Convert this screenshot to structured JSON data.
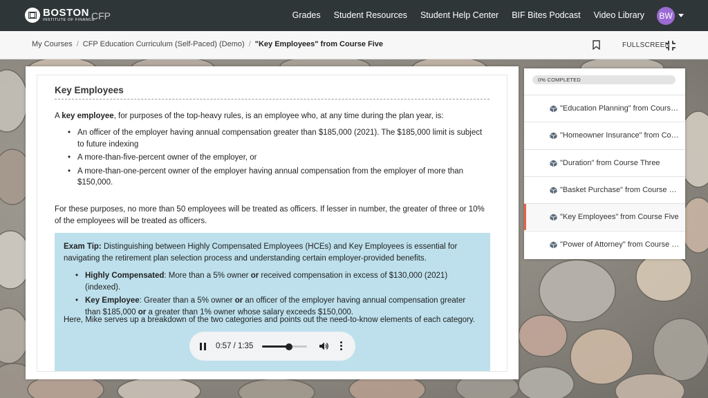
{
  "header": {
    "logo_main": "BOSTON",
    "logo_sub": "INSTITUTE OF FINANCE",
    "app_name": "CFP",
    "nav": [
      "Grades",
      "Student Resources",
      "Student Help Center",
      "BIF Bites Podcast",
      "Video Library"
    ],
    "avatar_initials": "BW"
  },
  "breadcrumb": {
    "items": [
      "My Courses",
      "CFP Education Curriculum (Self-Paced) (Demo)",
      "\"Key Employees\" from Course Five"
    ],
    "fullscreen_label": "FULLSCREEN"
  },
  "content": {
    "heading": "Key  Employees",
    "intro_pre": "A ",
    "intro_bold": "key employee",
    "intro_post": ", for purposes of the top-heavy rules, is an employee who, at any time during the plan year, is:",
    "bullets": [
      "An officer of the employer having annual compensation greater than $185,000 (2021). The $185,000 limit is subject to future indexing",
      "A more-than-five-percent owner of the employer, or",
      "A more-than-one-percent owner of the employer having annual compensation from the employer of more than $150,000."
    ],
    "para2": "For these purposes, no more than 50 employees will be treated as officers. If lesser in number, the greater of three or 10% of the employees will be treated as officers.",
    "tip_label": "Exam Tip:",
    "tip_text": " Distinguishing between Highly Compensated Employees (HCEs) and Key Employees is essential for navigating the retirement plan selection process and understanding certain employer-provided benefits.",
    "tip_b1_bold": "Highly Compensated",
    "tip_b1_a": ": More than a 5% owner ",
    "tip_b1_or": "or",
    "tip_b1_b": " received compensation in excess of $130,000 (2021) (indexed).",
    "tip_b2_bold": "Key Employee",
    "tip_b2_a": ": Greater than a 5% owner ",
    "tip_b2_or1": "or",
    "tip_b2_b": " an officer of the employer having annual compensation greater than $185,000 ",
    "tip_b2_or2": "or",
    "tip_b2_c": " a greater than 1% owner whose salary exceeds $150,000.",
    "tip_outro": "Here, Mike serves up a breakdown of the two categories and points out the need-to-know elements of each category."
  },
  "audio": {
    "time": "0:57 / 1:35",
    "progress": 0.6
  },
  "sidebar": {
    "progress_label": "0% COMPLETED",
    "lessons": [
      "\"Education Planning\" from Course One",
      "\"Homeowner Insurance\" from Course Two",
      "\"Duration\" from Course Three",
      "\"Basket Purchase\" from Course Four",
      "\"Key Employees\" from Course Five",
      "\"Power of Attorney\" from Course Six"
    ],
    "active_index": 4,
    "accent_color": "#e8654a"
  }
}
